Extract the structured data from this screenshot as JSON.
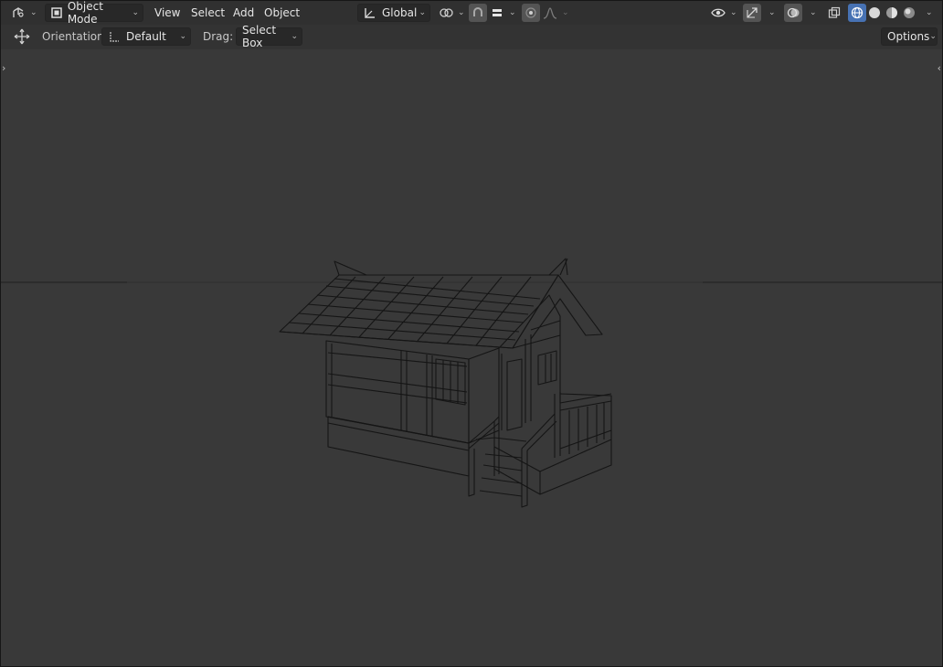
{
  "header": {
    "mode_label": "Object Mode",
    "menus": [
      "View",
      "Select",
      "Add",
      "Object"
    ],
    "orientation_global": "Global",
    "icons": {
      "editor_type": "editor-type-icon",
      "object_mode": "object-mode-icon",
      "transform_orientation": "transform-orientation-icon",
      "pivot": "pivot-point-icon",
      "snap": "snap-magnet-icon",
      "snap_increment": "snap-increment-icon",
      "proportional": "proportional-edit-icon",
      "falloff": "falloff-curve-icon",
      "visibility": "eye-icon",
      "gizmo": "gizmo-icon",
      "overlays": "overlays-icon",
      "xray": "xray-icon",
      "shading_wireframe": "wireframe-shading-icon",
      "shading_solid": "solid-shading-icon",
      "shading_material": "material-shading-icon",
      "shading_rendered": "rendered-shading-icon"
    }
  },
  "toolbar": {
    "orientation_label": "Orientation:",
    "orientation_value": "Default",
    "drag_label": "Drag:",
    "drag_value": "Select Box",
    "options_label": "Options"
  },
  "colors": {
    "viewport_bg": "#393939",
    "header_bg": "#303030",
    "active_shading": "#4772b3"
  }
}
